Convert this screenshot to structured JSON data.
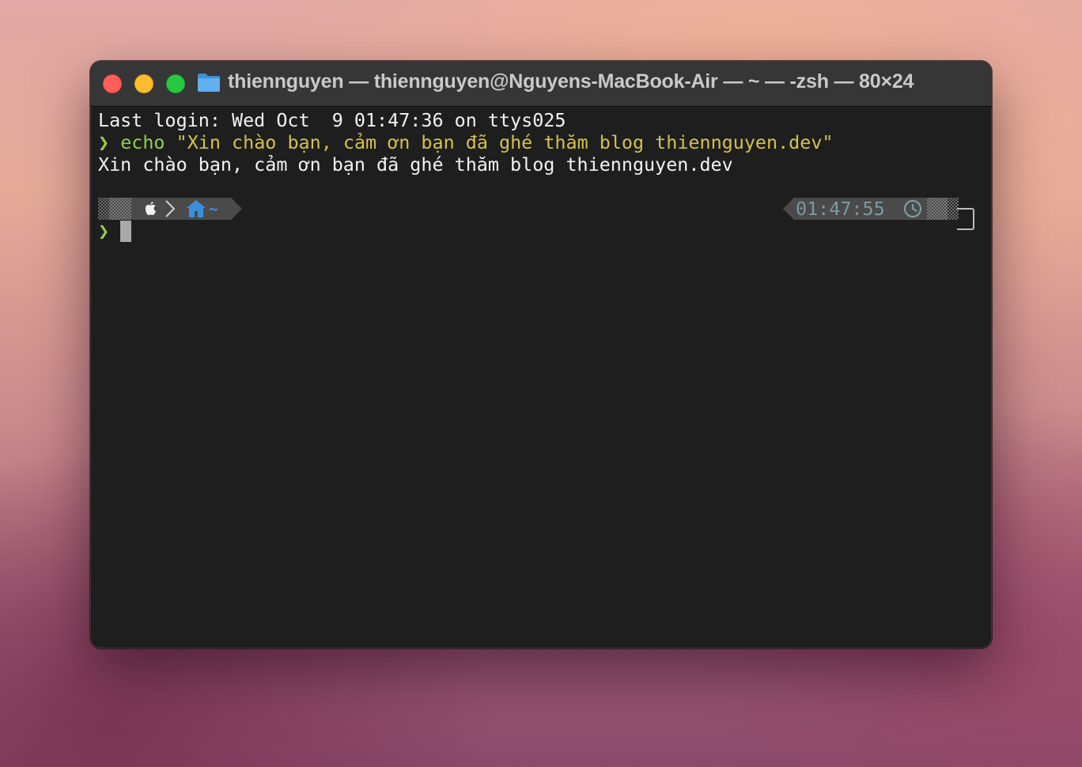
{
  "window": {
    "title": "thiennguyen — thiennguyen@Nguyens-MacBook-Air — ~ — -zsh — 80×24"
  },
  "terminal": {
    "login_line": "Last login: Wed Oct  9 01:47:36 on ttys025",
    "prompt_char": "❯",
    "command": "echo",
    "command_arg": "\"Xin chào bạn, cảm ơn bạn đã ghé thăm blog thiennguyen.dev\"",
    "output_line": "Xin chào bạn, cảm ơn bạn đã ghé thăm blog thiennguyen.dev",
    "prompt": {
      "os_icon": "apple-icon",
      "home_icon": "home-icon",
      "dir": "~",
      "time": "01:47:55",
      "clock_icon": "clock-icon"
    }
  },
  "colors": {
    "prompt_green": "#8fd14f",
    "string_yellow": "#d5c24a",
    "dir_blue": "#3b8fd9",
    "time_gray": "#7a9aa0",
    "segment_bg": "#4a4a4a"
  }
}
